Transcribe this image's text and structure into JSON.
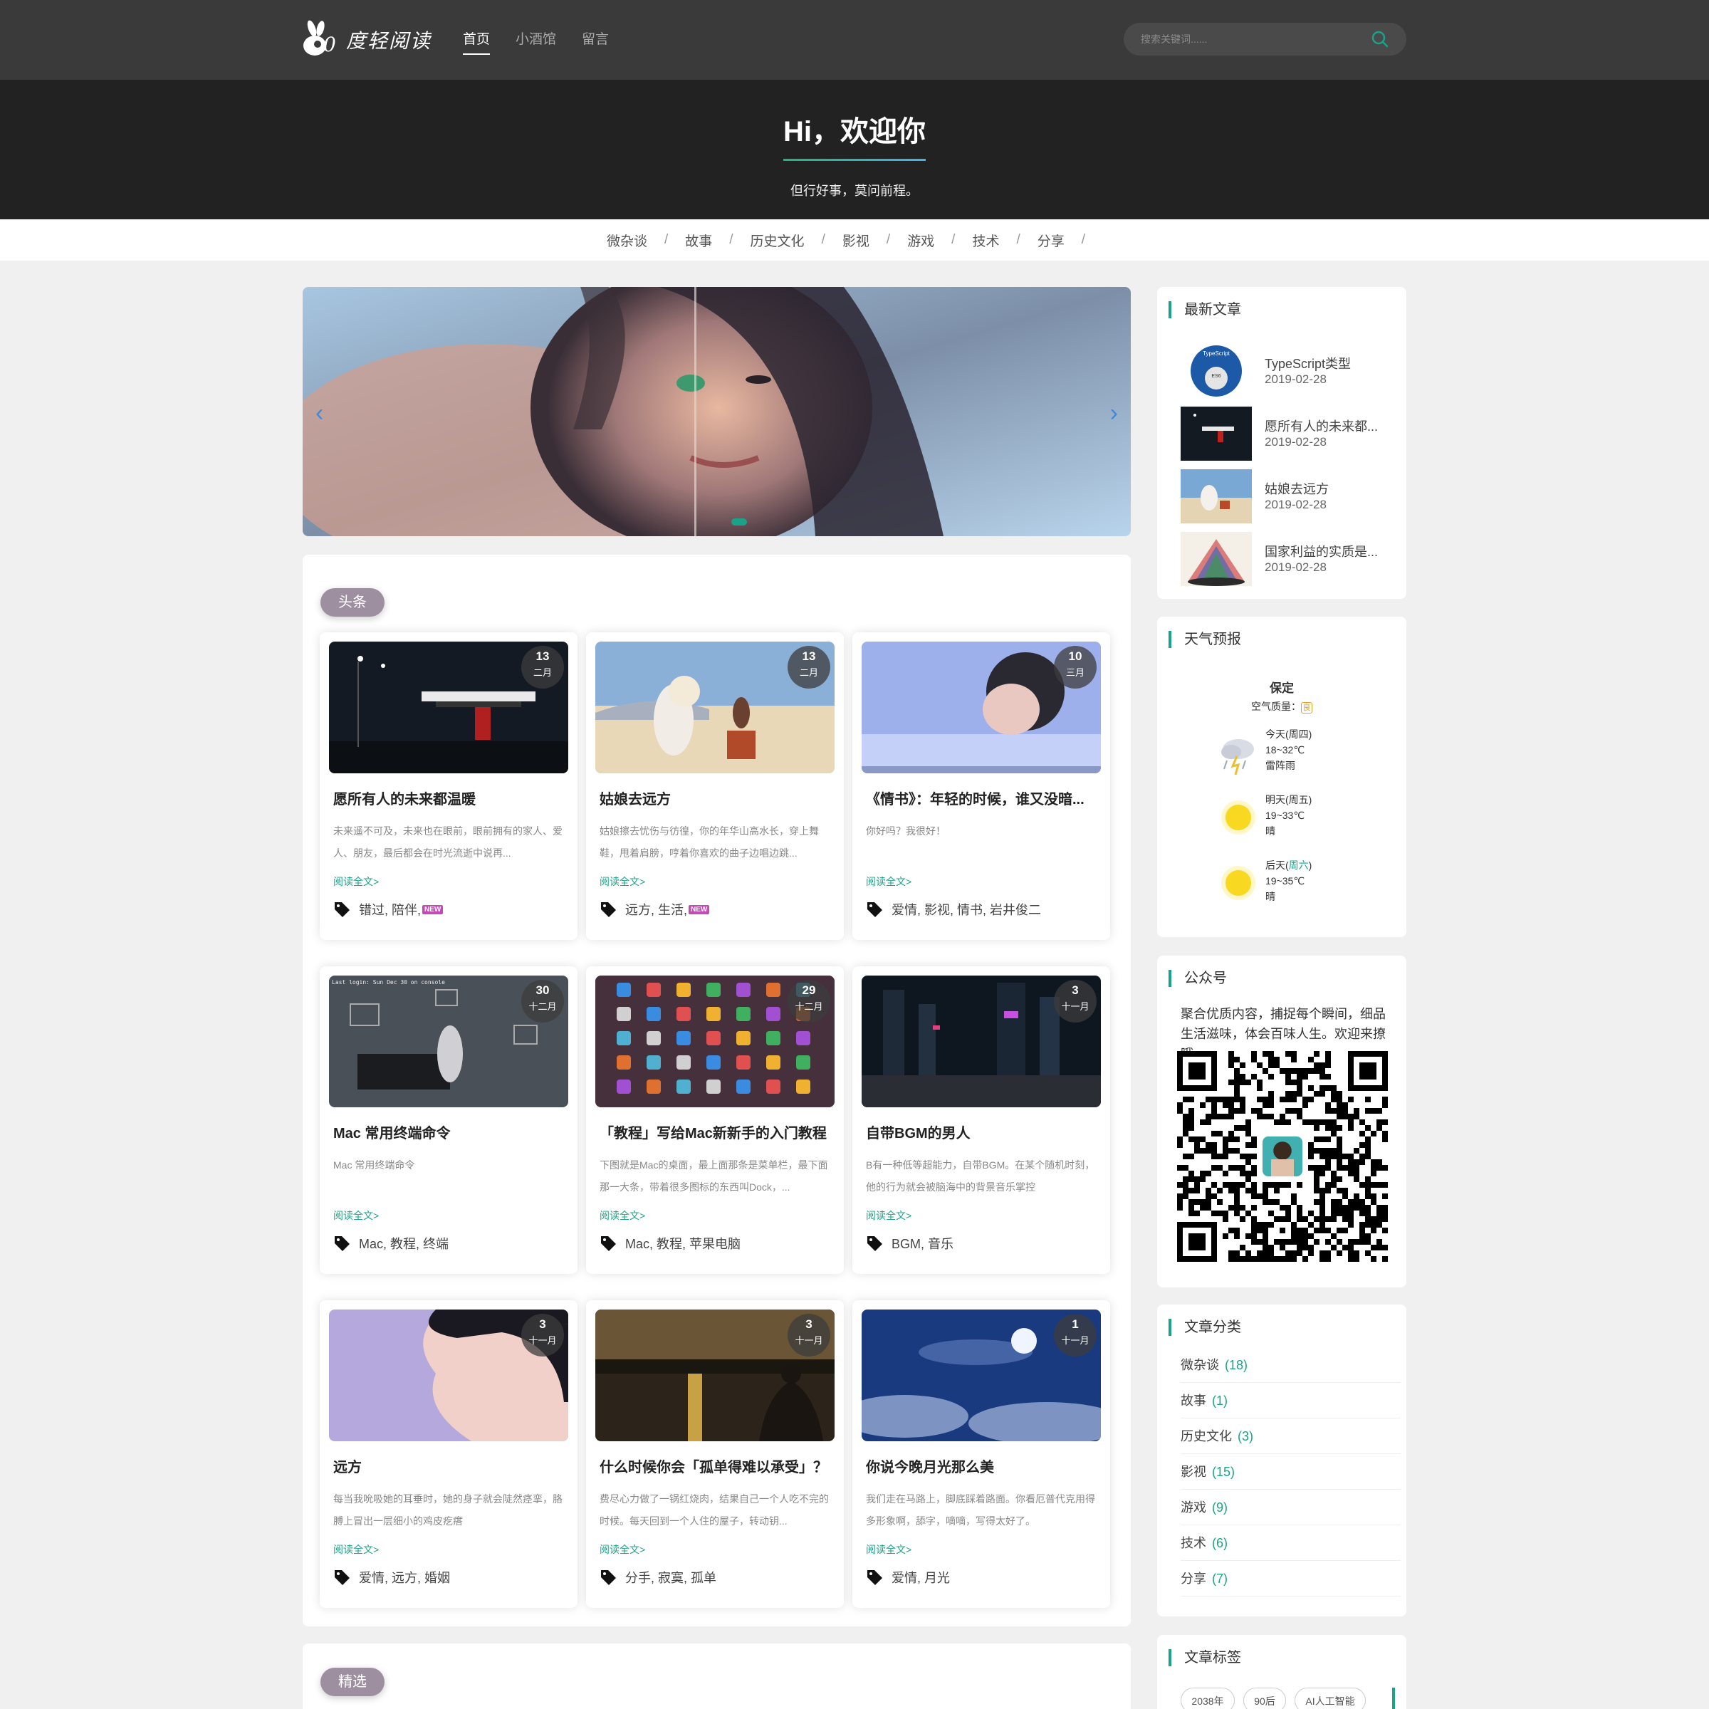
{
  "header": {
    "logo_text": "度轻阅读",
    "nav": [
      {
        "label": "首页",
        "active": true
      },
      {
        "label": "小酒馆",
        "active": false
      },
      {
        "label": "留言",
        "active": false
      }
    ],
    "search_placeholder": "搜索关键词......"
  },
  "hero": {
    "title": "Hi，欢迎你",
    "subtitle": "但行好事，莫问前程。"
  },
  "categories": [
    "微杂谈",
    "故事",
    "历史文化",
    "影视",
    "游戏",
    "技术",
    "分享"
  ],
  "sections": {
    "headline_label": "头条",
    "featured_label": "精选"
  },
  "read_more": "阅读全文>",
  "new_badge": "NEW",
  "articles": [
    {
      "day": "13",
      "month": "二月",
      "title": "愿所有人的未来都温暖",
      "excerpt": "未来遥不可及，未来也在眼前，眼前拥有的家人、爱人、朋友，最后都会在时光流逝中说再...",
      "tags": "错过, 陪伴,",
      "new": true
    },
    {
      "day": "13",
      "month": "二月",
      "title": "姑娘去远方",
      "excerpt": "姑娘擦去忧伤与彷徨，你的年华山高水长，穿上舞鞋，甩着肩膀，哼着你喜欢的曲子边唱边跳...",
      "tags": "远方, 生活,",
      "new": true
    },
    {
      "day": "10",
      "month": "三月",
      "title": "《情书》：年轻的时候，谁又没暗...",
      "excerpt": "你好吗？我很好！",
      "tags": "爱情, 影视, 情书, 岩井俊二",
      "new": false
    },
    {
      "day": "30",
      "month": "十二月",
      "title": "Mac 常用终端命令",
      "excerpt": "Mac 常用终端命令",
      "tags": "Mac, 教程, 终端",
      "new": false
    },
    {
      "day": "29",
      "month": "十二月",
      "title": "「教程」写给Mac新新手的入门教程",
      "excerpt": "下图就是Mac的桌面，最上面那条是菜单栏，最下面那一大条，带着很多图标的东西叫Dock，...",
      "tags": "Mac, 教程, 苹果电脑",
      "new": false
    },
    {
      "day": "3",
      "month": "十一月",
      "title": "自带BGM的男人",
      "excerpt": "B有一种低等超能力，自带BGM。在某个随机时刻，他的行为就会被脑海中的背景音乐掌控",
      "tags": "BGM, 音乐",
      "new": false
    },
    {
      "day": "3",
      "month": "十一月",
      "title": "远方",
      "excerpt": "每当我吮吸她的耳垂时，她的身子就会陡然痉挛，胳膊上冒出一层细小的鸡皮疙瘩",
      "tags": "爱情, 远方, 婚姻",
      "new": false
    },
    {
      "day": "3",
      "month": "十一月",
      "title": "什么时候你会「孤单得难以承受」？",
      "excerpt": "费尽心力做了一锅红烧肉，结果自己一个人吃不完的时候。每天回到一个人住的屋子，转动钥...",
      "tags": "分手, 寂寞, 孤单",
      "new": false
    },
    {
      "day": "1",
      "month": "十一月",
      "title": "你说今晚月光那么美",
      "excerpt": "我们走在马路上，脚底踩着路面。你看厄普代克用得多形象啊，舔字，嘀嘀，写得太好了。",
      "tags": "爱情, 月光",
      "new": false
    }
  ],
  "sidebar": {
    "recent_title": "最新文章",
    "recent": [
      {
        "title": "TypeScript类型",
        "date": "2019-02-28"
      },
      {
        "title": "愿所有人的未来都...",
        "date": "2019-02-28"
      },
      {
        "title": "姑娘去远方",
        "date": "2019-02-28"
      },
      {
        "title": "国家利益的实质是...",
        "date": "2019-02-28"
      }
    ],
    "weather_title": "天气预报",
    "weather": {
      "city": "保定",
      "aqi_label": "空气质量：",
      "aqi_value": "良",
      "days": [
        {
          "label": "今天(周四)",
          "temp": "18~32℃",
          "desc": "雷阵雨",
          "icon": "thunderstorm-icon"
        },
        {
          "label": "明天(周五)",
          "temp": "19~33℃",
          "desc": "晴",
          "icon": "sun-icon"
        },
        {
          "label_prefix": "后天(",
          "label_day": "周六",
          "label_suffix": ")",
          "temp": "19~35℃",
          "desc": "晴",
          "icon": "sun-icon"
        }
      ]
    },
    "wechat_title": "公众号",
    "wechat_desc": "聚合优质内容，捕捉每个瞬间，细品生活滋味，体会百味人生。欢迎来撩哦。",
    "category_title": "文章分类",
    "category_counts": [
      {
        "name": "微杂谈",
        "count": "(18)"
      },
      {
        "name": "故事",
        "count": "(1)"
      },
      {
        "name": "历史文化",
        "count": "(3)"
      },
      {
        "name": "影视",
        "count": "(15)"
      },
      {
        "name": "游戏",
        "count": "(9)"
      },
      {
        "name": "技术",
        "count": "(6)"
      },
      {
        "name": "分享",
        "count": "(7)"
      }
    ],
    "tags_title": "文章标签",
    "tags": [
      "2038年",
      "90后",
      "AI人工智能"
    ]
  },
  "colors": {
    "accent": "#1aa388",
    "topbar": "#3a3a3a",
    "hero": "#222222",
    "pill": "#9e8fa0",
    "new_badge": "#c44bb5"
  }
}
